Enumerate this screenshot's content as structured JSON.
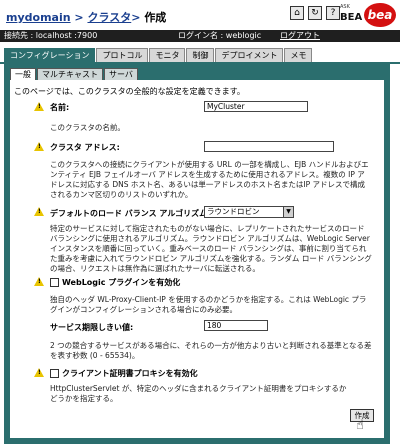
{
  "header": {
    "domain_link": "mydomain",
    "sep1": ">",
    "cluster_link": "クラスタ",
    "sep2": ">",
    "action": "作成",
    "ask_text": "ASK",
    "bea_text": "BEA",
    "logo_text": "bea"
  },
  "status": {
    "connection": "接続先 : localhost :7900",
    "login": "ログイン名 : weblogic",
    "logout": "ログアウト"
  },
  "tabs_top": [
    "コンフィグレーション",
    "プロトコル",
    "モニタ",
    "制御",
    "デプロイメント",
    "メモ"
  ],
  "tabs_sub": [
    "一般",
    "マルチキャスト",
    "サーバ"
  ],
  "intro": "このページでは、このクラスタの全般的な設定を定義できます。",
  "name_field": {
    "label": "名前:",
    "value": "MyCluster",
    "desc": "このクラスタの名前。"
  },
  "address_field": {
    "label": "クラスタ アドレス:",
    "value": "",
    "desc": "このクラスタへの接続にクライアントが使用する URL の一部を構成し、EJB ハンドルおよびエンティティ EJB フェイルオーバ アドレスを生成するために使用されるアドレス。複数の IP アドレスに対応する DNS ホスト名、あるいは単一アドレスのホスト名またはIP アドレスで構成されるカンマ区切りのリストのいずれか。"
  },
  "lb_field": {
    "label": "デフォルトのロード バランス アルゴリズム:",
    "value": "ラウンドロビン",
    "desc": "特定のサービスに対して指定されたものがない場合に、レプリケートされたサービスのロード バランシングに使用されるアルゴリズム。ラウンドロビン アルゴリズムは、WebLogic Server インスタンスを順番に回っていく。重みベースのロード バランシングは、事前に割り当てられた重みを考慮に入れてラウンドロビン アルゴリズムを強化する。ランダム ロード バランシングの場合、リクエストは無作為に選ばれたサーバに転送される。"
  },
  "plugin_field": {
    "label": "WebLogic プラグインを有効化",
    "desc": "独自のヘッダ WL-Proxy-Client-IP を使用するのかどうかを指定する。これは WebLogic プラグインがコンフィグレーションされる場合にのみ必要。"
  },
  "threshold_field": {
    "label": "サービス期限しきい値:",
    "value": "180",
    "desc": "2 つの競合するサービスがある場合に、それらの一方が他方より古いと判断される基準となる差を表す秒数 (0 - 65534)。"
  },
  "certproxy_field": {
    "label": "クライアント証明書プロキシを有効化",
    "desc": "HttpClusterServlet が、特定のヘッダに含まれるクライアント証明書をプロキシするかどうかを指定する。"
  },
  "create_button": "作成"
}
